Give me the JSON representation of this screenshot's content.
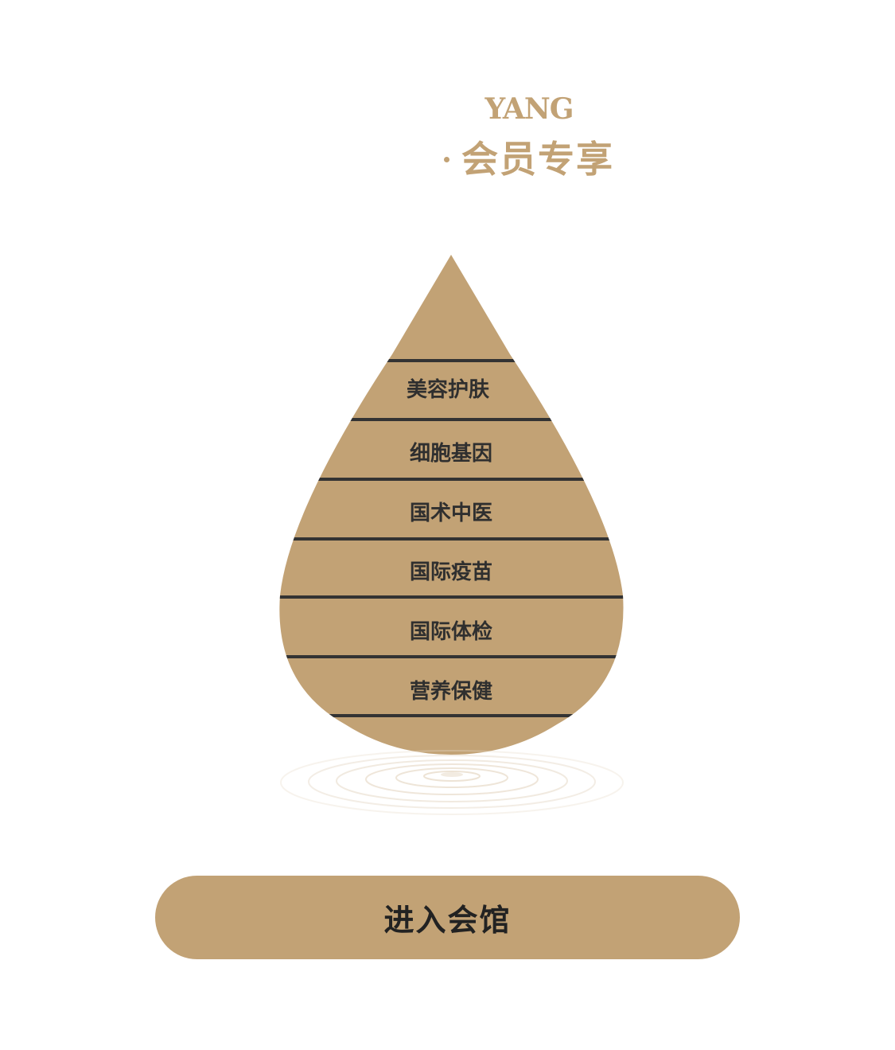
{
  "brand": {
    "name": "YANG",
    "subtitle": "会员专享"
  },
  "categories": [
    "美容护肤",
    "细胞基因",
    "国术中医",
    "国际疫苗",
    "国际体检",
    "营养保健"
  ],
  "enter_button": {
    "label": "进入会馆"
  },
  "colors": {
    "accent": "#c2a275",
    "divider": "#333333",
    "label": "#2f2f2f"
  }
}
